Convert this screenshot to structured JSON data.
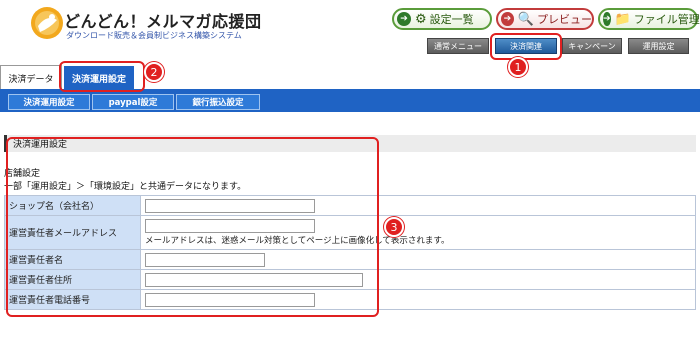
{
  "brand": {
    "title": "どんどん！メルマガ応援団",
    "subtitle": "ダウンロード販売＆会員制ビジネス構築システム"
  },
  "top_buttons": [
    {
      "label": "設定一覧",
      "icon": "gear-icon"
    },
    {
      "label": "プレビュー",
      "icon": "magnifier-icon"
    },
    {
      "label": "ファイル管理",
      "icon": "folder-icon"
    }
  ],
  "menu_buttons": [
    {
      "label": "通常メニュー"
    },
    {
      "label": "決済関連"
    },
    {
      "label": "キャンペーン"
    },
    {
      "label": "運用設定"
    }
  ],
  "tabs": [
    {
      "label": "決済データ"
    },
    {
      "label": "決済運用設定"
    }
  ],
  "subnav": [
    {
      "label": "決済運用設定"
    },
    {
      "label": "paypal設定"
    },
    {
      "label": "銀行振込設定"
    }
  ],
  "callouts": [
    "1",
    "2",
    "3"
  ],
  "section": {
    "title": "決済運用設定",
    "group_label": "店舗設定",
    "note": "一部「運用設定」＞「環境設定」と共通データになります。"
  },
  "form": {
    "rows": [
      {
        "label": "ショップ名（会社名）",
        "value": "",
        "help": ""
      },
      {
        "label": "運営責任者メールアドレス",
        "value": "",
        "help": "メールアドレスは、迷惑メール対策としてページ上に画像化して表示されます。"
      },
      {
        "label": "運営責任者名",
        "value": "",
        "help": ""
      },
      {
        "label": "運営責任者住所",
        "value": "",
        "help": ""
      },
      {
        "label": "運営責任者電話番号",
        "value": "",
        "help": ""
      }
    ]
  },
  "colors": {
    "primary_blue": "#1f63c4",
    "highlight_red": "#e02020",
    "label_bg": "#cfe0f6"
  }
}
